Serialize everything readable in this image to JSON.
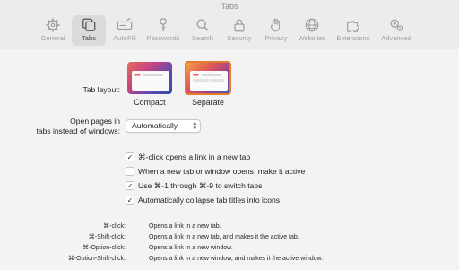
{
  "window": {
    "title": "Tabs"
  },
  "toolbar": {
    "items": [
      {
        "label": "General",
        "icon": "gear-icon"
      },
      {
        "label": "Tabs",
        "icon": "tabs-icon",
        "active": true
      },
      {
        "label": "AutoFill",
        "icon": "autofill-icon"
      },
      {
        "label": "Passwords",
        "icon": "key-icon"
      },
      {
        "label": "Search",
        "icon": "search-icon"
      },
      {
        "label": "Security",
        "icon": "lock-icon"
      },
      {
        "label": "Privacy",
        "icon": "hand-icon"
      },
      {
        "label": "Websites",
        "icon": "globe-icon"
      },
      {
        "label": "Extensions",
        "icon": "puzzle-icon"
      },
      {
        "label": "Advanced",
        "icon": "gears-icon"
      }
    ]
  },
  "tab_layout": {
    "label": "Tab layout:",
    "options": [
      {
        "label": "Compact",
        "selected": false
      },
      {
        "label": "Separate",
        "selected": true
      }
    ]
  },
  "open_pages": {
    "label_line1": "Open pages in",
    "label_line2": "tabs instead of windows:",
    "value": "Automatically"
  },
  "checkboxes": [
    {
      "label": "⌘-click opens a link in a new tab",
      "checked": true
    },
    {
      "label": "When a new tab or window opens, make it active",
      "checked": false
    },
    {
      "label": "Use ⌘-1 through ⌘-9 to switch tabs",
      "checked": true
    },
    {
      "label": "Automatically collapse tab titles into icons",
      "checked": true
    }
  ],
  "shortcuts": [
    {
      "key": "⌘-click:",
      "desc": "Opens a link in a new tab."
    },
    {
      "key": "⌘-Shift-click:",
      "desc": "Opens a link in a new tab, and makes it the active tab."
    },
    {
      "key": "⌘-Option-click:",
      "desc": "Opens a link in a new window."
    },
    {
      "key": "⌘-Option-Shift-click:",
      "desc": "Opens a link in a new window, and makes it the active window."
    }
  ],
  "colors": {
    "accent": "#e07b2f",
    "background": "#f3f3f3",
    "toolbar": "#ececec"
  }
}
